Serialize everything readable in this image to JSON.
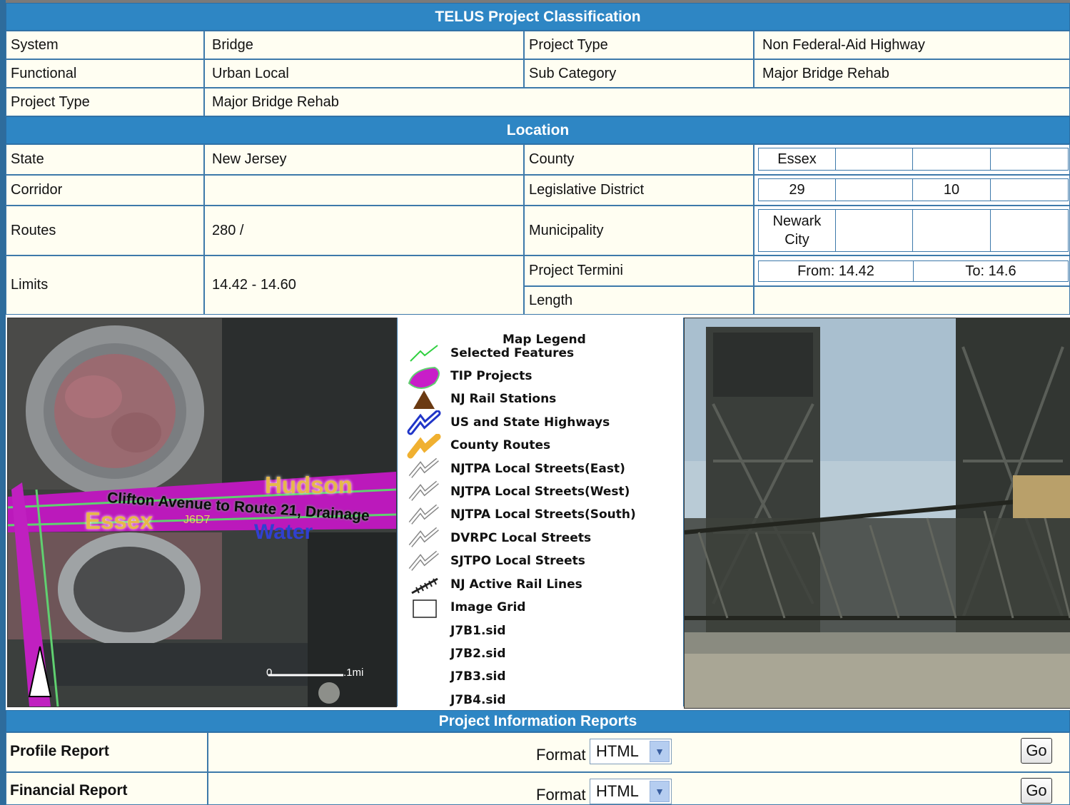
{
  "classification": {
    "header": "TELUS Project Classification",
    "rows": [
      {
        "l1": "System",
        "v1": "Bridge",
        "l2": "Project Type",
        "v2": "Non Federal-Aid Highway"
      },
      {
        "l1": "Functional",
        "v1": "Urban Local",
        "l2": "Sub Category",
        "v2": "Major Bridge Rehab"
      },
      {
        "l1": "Project Type",
        "v1": "Major Bridge Rehab"
      }
    ]
  },
  "location": {
    "header": "Location",
    "state_label": "State",
    "state_value": "New Jersey",
    "county_label": "County",
    "county_values": [
      "Essex",
      "",
      "",
      ""
    ],
    "corridor_label": "Corridor",
    "corridor_value": "",
    "legislative_label": "Legislative District",
    "legislative_values": [
      "29",
      "",
      "10",
      ""
    ],
    "routes_label": "Routes",
    "routes_value": "280 /",
    "municipality_label": "Municipality",
    "municipality_values": [
      "Newark City",
      "",
      "",
      ""
    ],
    "limits_label": "Limits",
    "limits_value": "14.42 - 14.60",
    "termini_label": "Project Termini",
    "termini_from": "From: 14.42",
    "termini_to": "To: 14.6",
    "length_label": "Length",
    "length_value": ""
  },
  "map": {
    "labels": {
      "hudson": "Hudson",
      "essex": "Essex",
      "route": "Clifton Avenue to Route 21, Drainage",
      "water": "Water",
      "grid": "J6D7",
      "scale_start": "0",
      "scale_end": ".1mi"
    },
    "colors": {
      "tip": "#c81ec8",
      "highway": "#2035c8",
      "county": "#f0b030",
      "selected": "#30d040"
    }
  },
  "legend": {
    "title": "Map Legend",
    "items": [
      {
        "label": "Selected Features",
        "icon": "selected-features-icon"
      },
      {
        "label": "TIP Projects",
        "icon": "tip-projects-icon"
      },
      {
        "label": "NJ Rail Stations",
        "icon": "rail-station-icon"
      },
      {
        "label": "US and State Highways",
        "icon": "highway-icon"
      },
      {
        "label": "County Routes",
        "icon": "county-route-icon"
      },
      {
        "label": "NJTPA Local Streets(East)",
        "icon": "local-street-icon"
      },
      {
        "label": "NJTPA Local Streets(West)",
        "icon": "local-street-icon"
      },
      {
        "label": "NJTPA Local Streets(South)",
        "icon": "local-street-icon"
      },
      {
        "label": "DVRPC Local Streets",
        "icon": "local-street-icon"
      },
      {
        "label": "SJTPO Local Streets",
        "icon": "local-street-icon"
      },
      {
        "label": "NJ Active Rail Lines",
        "icon": "rail-line-icon"
      },
      {
        "label": "Image Grid",
        "icon": "image-grid-icon"
      },
      {
        "label": "J7B1.sid",
        "icon": ""
      },
      {
        "label": "J7B2.sid",
        "icon": ""
      },
      {
        "label": "J7B3.sid",
        "icon": ""
      },
      {
        "label": "J7B4.sid",
        "icon": ""
      }
    ]
  },
  "reports": {
    "header": "Project Information Reports",
    "items": [
      {
        "label": "Profile Report",
        "format_label": "Format",
        "format_value": "HTML",
        "go": "Go"
      },
      {
        "label": "Financial Report",
        "format_label": "Format",
        "format_value": "HTML",
        "go": "Go"
      }
    ]
  }
}
